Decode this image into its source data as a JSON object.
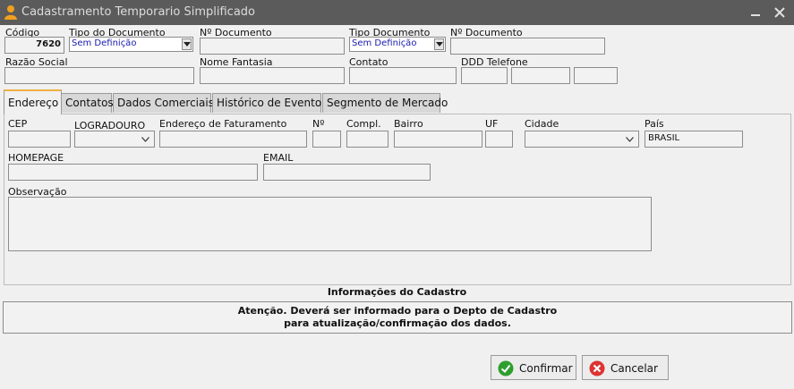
{
  "window": {
    "title": "Cadastramento Temporario Simplificado"
  },
  "header": {
    "codigo_label": "Código",
    "codigo_value": "7620",
    "tipo_documento_label": "Tipo do Documento",
    "tipo_documento_value": "Sem Definição",
    "n_documento_label": "Nº Documento",
    "n_documento_value": "",
    "tipo_documento2_label": "Tipo Documento",
    "tipo_documento2_value": "Sem Definição",
    "n_documento2_label": "Nº Documento",
    "n_documento2_value": "",
    "razao_social_label": "Razão Social",
    "razao_social_value": "",
    "nome_fantasia_label": "Nome Fantasia",
    "nome_fantasia_value": "",
    "contato_label": "Contato",
    "contato_value": "",
    "ddd_telefone_label": "DDD Telefone"
  },
  "tabs": [
    {
      "label": "Endereço"
    },
    {
      "label": "Contatos"
    },
    {
      "label": "Dados Comerciais"
    },
    {
      "label": "Histórico de Eventos"
    },
    {
      "label": "Segmento de Mercado"
    }
  ],
  "endereco": {
    "cep_label": "CEP",
    "logradouro_label": "LOGRADOURO",
    "endereco_faturamento_label": "Endereço de Faturamento",
    "numero_label": "Nº",
    "compl_label": "Compl.",
    "bairro_label": "Bairro",
    "uf_label": "UF",
    "cidade_label": "Cidade",
    "pais_label": "País",
    "pais_value": "BRASIL",
    "homepage_label": "HOMEPAGE",
    "email_label": "EMAIL",
    "observacao_label": "Observação"
  },
  "info": {
    "title": "Informações do Cadastro",
    "line1": "Atenção. Deverá ser informado para o Depto de Cadastro",
    "line2": "para atualização/confirmação dos dados."
  },
  "buttons": {
    "confirmar": "Confirmar",
    "cancelar": "Cancelar"
  },
  "colors": {
    "titlebar": "#5b5b5b",
    "tab_accent": "#f0b040",
    "combo_text": "#1a1ab0"
  }
}
